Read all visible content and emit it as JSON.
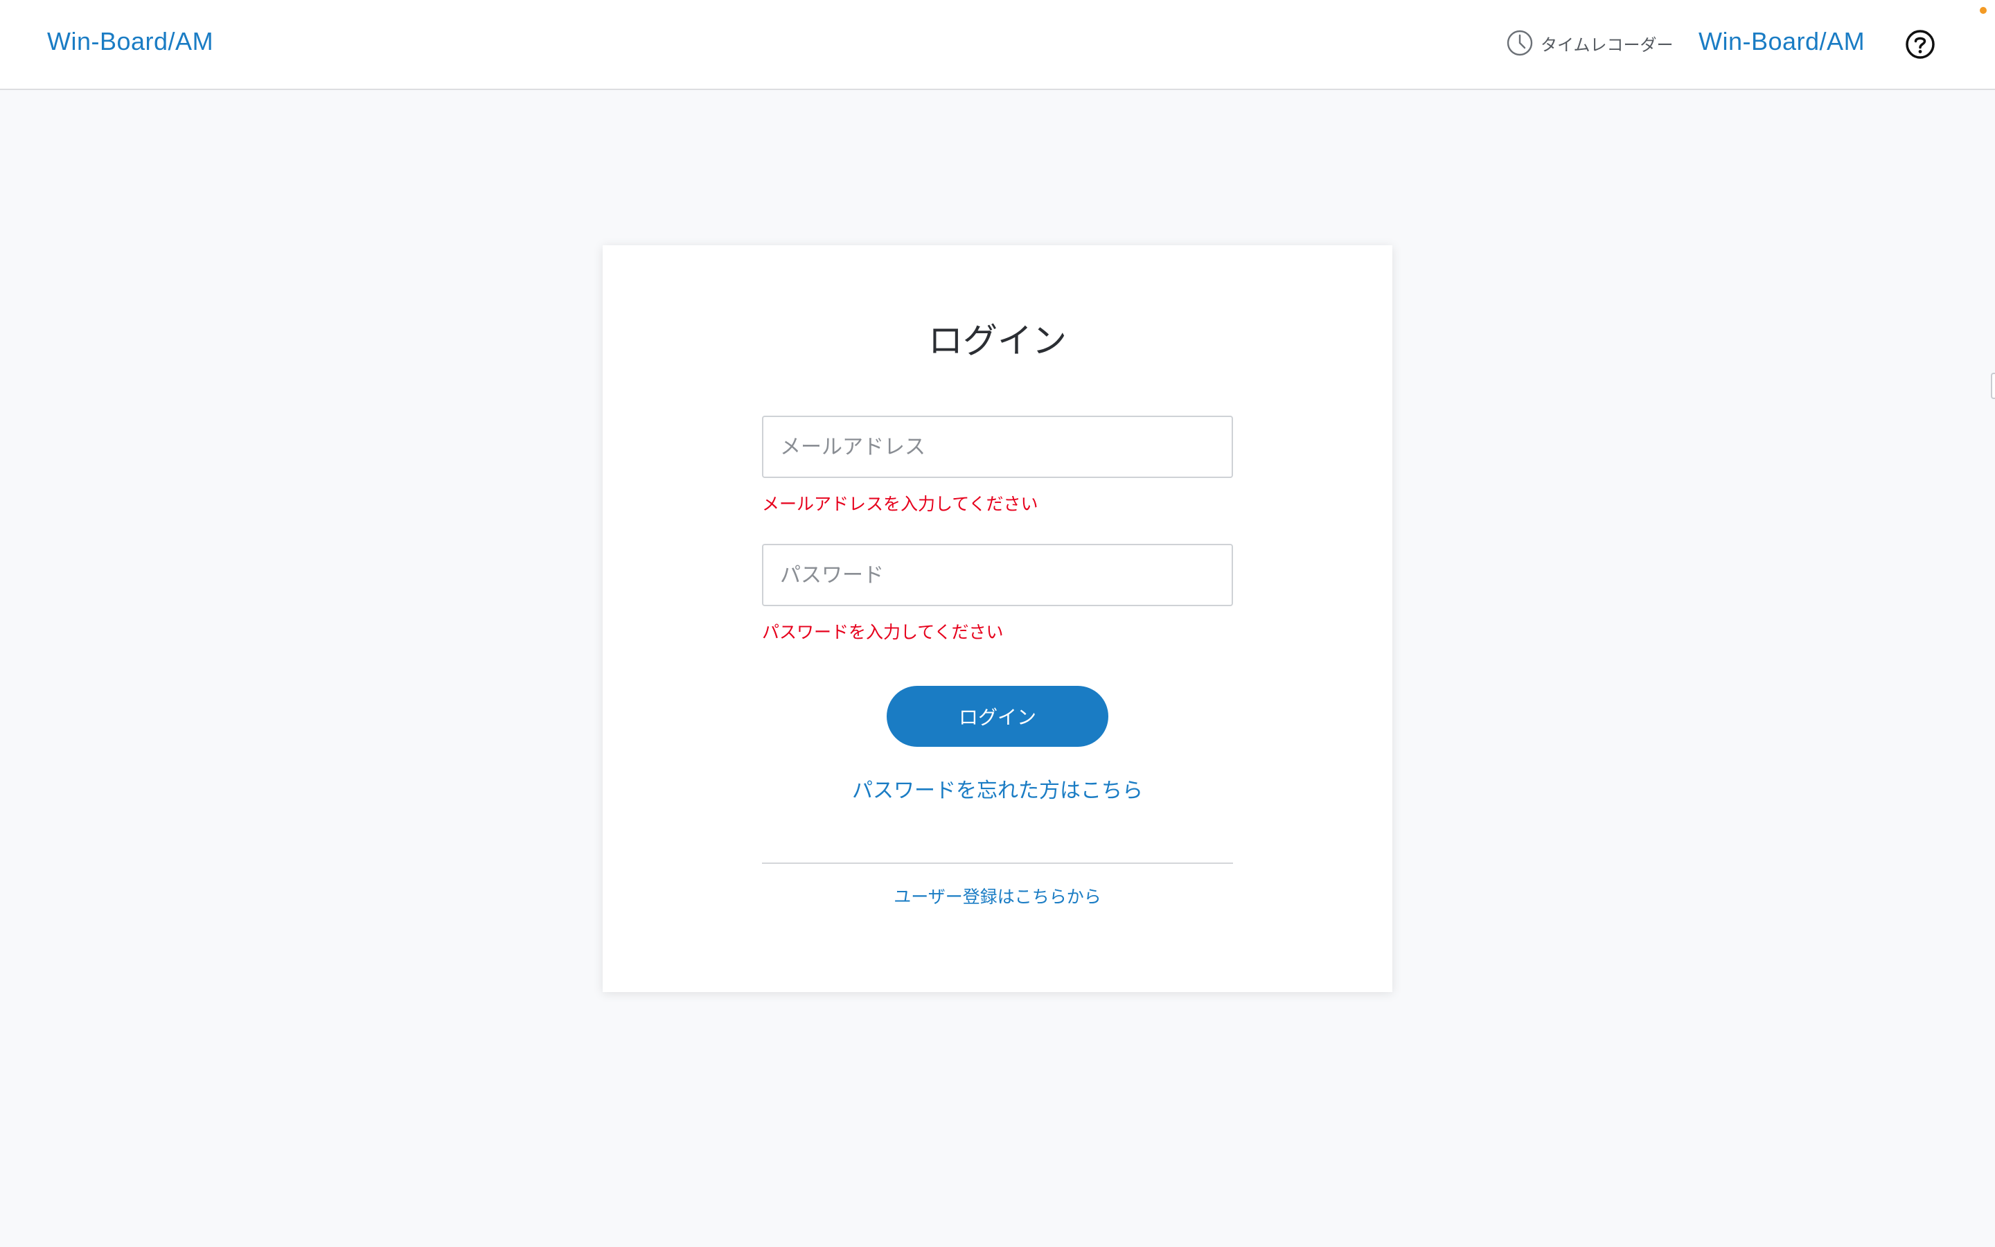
{
  "header": {
    "logo": "Win-Board/AM",
    "time_recorder_label": "タイムレコーダー",
    "logo_right": "Win-Board/AM",
    "icons": {
      "clock": "clock-icon",
      "help": "question-circle-icon"
    },
    "accent_color": "#1a7cc4",
    "notification_dot_color": "#f39a24"
  },
  "login": {
    "title": "ログイン",
    "email_placeholder": "メールアドレス",
    "email_error": "メールアドレスを入力してください",
    "password_placeholder": "パスワード",
    "password_error": "パスワードを入力してください",
    "submit_label": "ログイン",
    "forgot_password_link": "パスワードを忘れた方はこちら",
    "register_link": "ユーザー登録はこちらから",
    "error_color": "#e6001c"
  }
}
